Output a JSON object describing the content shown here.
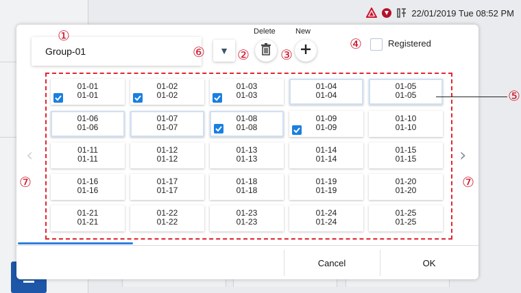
{
  "status": {
    "datetime": "22/01/2019 Tue 08:52 PM",
    "icons": [
      "warning-triangle-icon",
      "shield-icon",
      "tools-icon"
    ]
  },
  "group": {
    "name": "Group-01"
  },
  "toolbar": {
    "delete_label": "Delete",
    "new_label": "New"
  },
  "registered": {
    "label": "Registered",
    "checked": false
  },
  "markers": {
    "m1": "①",
    "m2": "②",
    "m3": "③",
    "m4": "④",
    "m5": "⑤",
    "m6": "⑥",
    "m7": "⑦"
  },
  "grid": {
    "rows": [
      [
        {
          "l1": "01-01",
          "l2": "01-01",
          "checked": true,
          "highlight": false
        },
        {
          "l1": "01-02",
          "l2": "01-02",
          "checked": true,
          "highlight": false
        },
        {
          "l1": "01-03",
          "l2": "01-03",
          "checked": true,
          "highlight": false
        },
        {
          "l1": "01-04",
          "l2": "01-04",
          "checked": false,
          "highlight": true
        },
        {
          "l1": "01-05",
          "l2": "01-05",
          "checked": false,
          "highlight": true
        }
      ],
      [
        {
          "l1": "01-06",
          "l2": "01-06",
          "checked": false,
          "highlight": true
        },
        {
          "l1": "01-07",
          "l2": "01-07",
          "checked": false,
          "highlight": true
        },
        {
          "l1": "01-08",
          "l2": "01-08",
          "checked": true,
          "highlight": true
        },
        {
          "l1": "01-09",
          "l2": "01-09",
          "checked": true,
          "highlight": false
        },
        {
          "l1": "01-10",
          "l2": "01-10",
          "checked": false,
          "highlight": false
        }
      ],
      [
        {
          "l1": "01-11",
          "l2": "01-11",
          "checked": false,
          "highlight": false
        },
        {
          "l1": "01-12",
          "l2": "01-12",
          "checked": false,
          "highlight": false
        },
        {
          "l1": "01-13",
          "l2": "01-13",
          "checked": false,
          "highlight": false
        },
        {
          "l1": "01-14",
          "l2": "01-14",
          "checked": false,
          "highlight": false
        },
        {
          "l1": "01-15",
          "l2": "01-15",
          "checked": false,
          "highlight": false
        }
      ],
      [
        {
          "l1": "01-16",
          "l2": "01-16",
          "checked": false,
          "highlight": false
        },
        {
          "l1": "01-17",
          "l2": "01-17",
          "checked": false,
          "highlight": false
        },
        {
          "l1": "01-18",
          "l2": "01-18",
          "checked": false,
          "highlight": false
        },
        {
          "l1": "01-19",
          "l2": "01-19",
          "checked": false,
          "highlight": false
        },
        {
          "l1": "01-20",
          "l2": "01-20",
          "checked": false,
          "highlight": false
        }
      ],
      [
        {
          "l1": "01-21",
          "l2": "01-21",
          "checked": false,
          "highlight": false
        },
        {
          "l1": "01-22",
          "l2": "01-22",
          "checked": false,
          "highlight": false
        },
        {
          "l1": "01-23",
          "l2": "01-23",
          "checked": false,
          "highlight": false
        },
        {
          "l1": "01-24",
          "l2": "01-24",
          "checked": false,
          "highlight": false
        },
        {
          "l1": "01-25",
          "l2": "01-25",
          "checked": false,
          "highlight": false
        }
      ]
    ]
  },
  "page_progress": 0.25,
  "nav": {
    "prev_icon": "chevron-left-icon",
    "next_icon": "chevron-right-icon",
    "prev_glyph": "‹",
    "next_glyph": "›"
  },
  "footer": {
    "cancel_label": "Cancel",
    "ok_label": "OK"
  },
  "colors": {
    "accent": "#1a7fe0",
    "marker": "#d0152a",
    "frame": "#e0242f",
    "warning": "#d0152a"
  }
}
